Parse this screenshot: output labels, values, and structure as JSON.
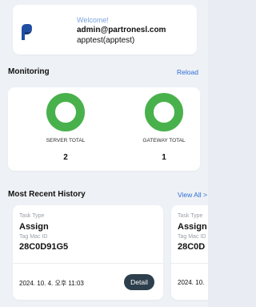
{
  "user": {
    "welcome": "Welcome!",
    "email": "admin@partronesl.com",
    "username": "apptest(apptest)",
    "logo_icon": "partron-logo"
  },
  "monitoring": {
    "title": "Monitoring",
    "reload_label": "Reload",
    "metrics": [
      {
        "label": "SERVER TOTAL",
        "value": "2"
      },
      {
        "label": "GATEWAY TOTAL",
        "value": "1"
      }
    ],
    "ring_color": "#49b14c"
  },
  "history": {
    "title": "Most Recent History",
    "view_all_label": "View All >",
    "items": [
      {
        "type_label": "Task Type",
        "type": "Assign",
        "mac_label": "Tag Mac ID",
        "mac": "28C0D91G5",
        "date": "2024. 10. 4. 오후 11:03",
        "detail_label": "Detail"
      },
      {
        "type_label": "Task Type",
        "type": "Assign",
        "mac_label": "Tag Mac ID",
        "mac": "28C0D",
        "date": "2024. 10."
      }
    ]
  },
  "colors": {
    "accent": "#2e6fd6",
    "button_dark": "#2d3f4c",
    "background": "#eef1f5"
  }
}
